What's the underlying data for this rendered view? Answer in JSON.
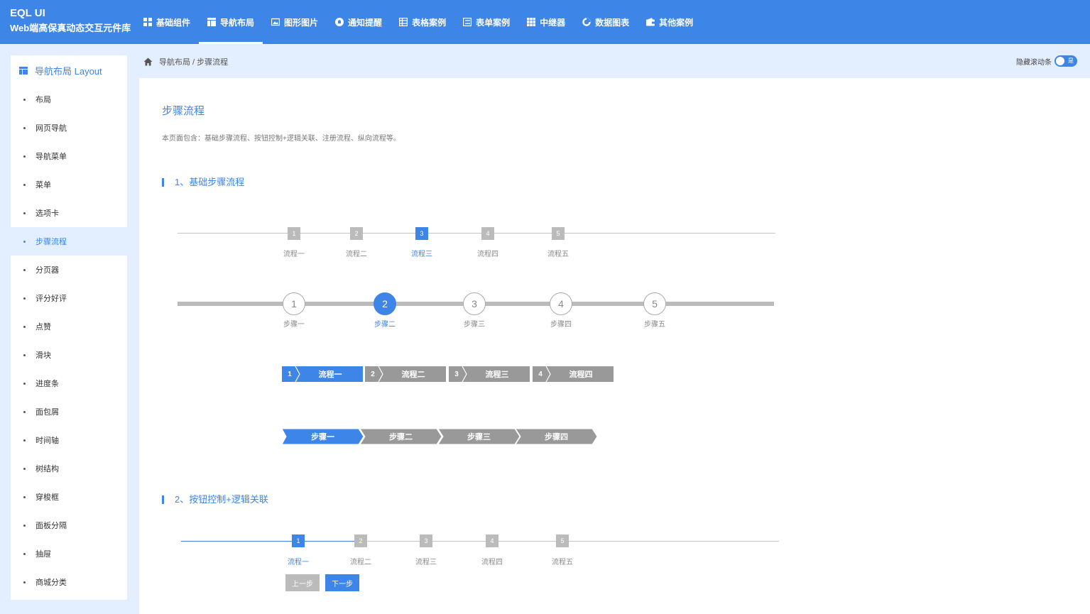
{
  "brand": {
    "title": "EQL UI",
    "subtitle": "Web端高保真动态交互元件库"
  },
  "nav": [
    {
      "label": "基础组件",
      "icon": "grid-icon"
    },
    {
      "label": "导航布局",
      "icon": "layout-icon",
      "active": true
    },
    {
      "label": "图形图片",
      "icon": "image-icon"
    },
    {
      "label": "通知提醒",
      "icon": "bell-icon"
    },
    {
      "label": "表格案例",
      "icon": "table-icon"
    },
    {
      "label": "表单案例",
      "icon": "form-icon"
    },
    {
      "label": "中继器",
      "icon": "repeater-icon"
    },
    {
      "label": "数据图表",
      "icon": "chart-icon"
    },
    {
      "label": "其他案例",
      "icon": "wallet-icon"
    }
  ],
  "sidebar": {
    "header": "导航布局 Layout",
    "items": [
      "布局",
      "网页导航",
      "导航菜单",
      "菜单",
      "选项卡",
      "步骤流程",
      "分页器",
      "评分好评",
      "点赞",
      "滑块",
      "进度条",
      "面包屑",
      "时间轴",
      "树结构",
      "穿梭框",
      "面板分隔",
      "抽屉",
      "商城分类"
    ],
    "active_index": 5
  },
  "breadcrumb": "导航布局 / 步骤流程",
  "scroll_toggle": {
    "label": "隐藏滚动条",
    "state": "是"
  },
  "page": {
    "title": "步骤流程",
    "desc": "本页面包含：基础步骤流程、按钮控制+逻辑关联、注册流程、纵向流程等。"
  },
  "section1": {
    "title": "1、基础步骤流程",
    "row1": {
      "nums": [
        "1",
        "2",
        "3",
        "4",
        "5"
      ],
      "labels": [
        "流程一",
        "流程二",
        "流程三",
        "流程四",
        "流程五"
      ],
      "active": 2
    },
    "row2": {
      "nums": [
        "1",
        "2",
        "3",
        "4",
        "5"
      ],
      "labels": [
        "步骤一",
        "步骤二",
        "步骤三",
        "步骤四",
        "步骤五"
      ],
      "active": 1
    },
    "row3": {
      "nums": [
        "1",
        "2",
        "3",
        "4"
      ],
      "labels": [
        "流程一",
        "流程二",
        "流程三",
        "流程四"
      ],
      "active": 0
    },
    "row4": {
      "labels": [
        "步骤一",
        "步骤二",
        "步骤三",
        "步骤四"
      ],
      "active": 0
    }
  },
  "section2": {
    "title": "2、按钮控制+逻辑关联",
    "row": {
      "nums": [
        "1",
        "2",
        "3",
        "4",
        "5"
      ],
      "labels": [
        "流程一",
        "流程二",
        "流程三",
        "流程四",
        "流程五"
      ],
      "active": 0
    },
    "prev_label": "上一步",
    "next_label": "下一步"
  },
  "colors": {
    "accent": "#3d85e6",
    "inactive": "#999999",
    "light_bg": "#e3efff"
  }
}
